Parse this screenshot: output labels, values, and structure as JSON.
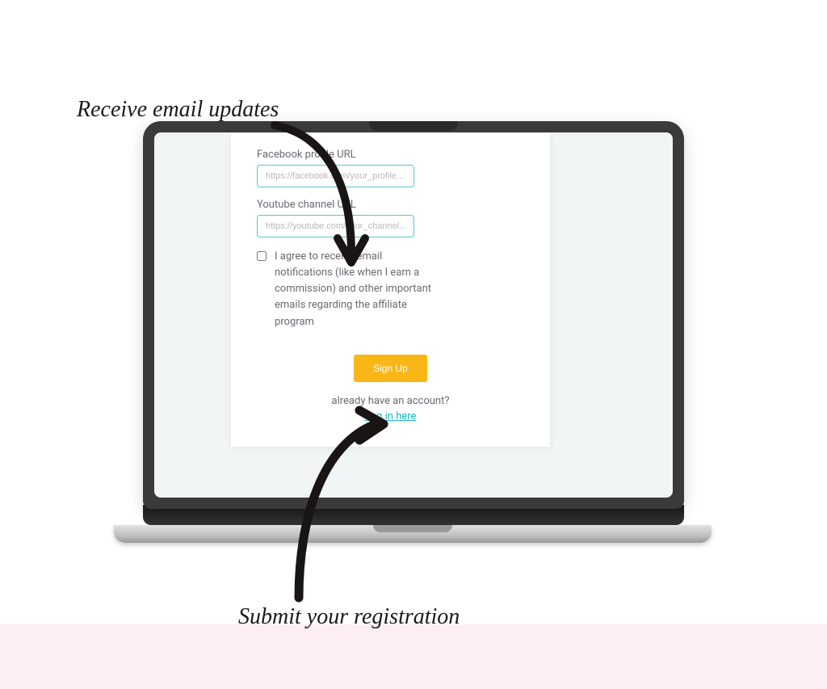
{
  "annotations": {
    "top": "Receive email updates",
    "bottom": "Submit your registration"
  },
  "form": {
    "facebook": {
      "label": "Facebook profile URL",
      "placeholder": "https://facebook.com/your_profile..."
    },
    "youtube": {
      "label": "Youtube channel URL",
      "placeholder": "https://youtube.com/your_channel..."
    },
    "consent": "I agree to receive email notifications (like when I earn a commission) and other important emails regarding the affiliate program",
    "signup_label": "Sign Up",
    "already_text": "already have an account?",
    "login_link": "Log in here"
  }
}
